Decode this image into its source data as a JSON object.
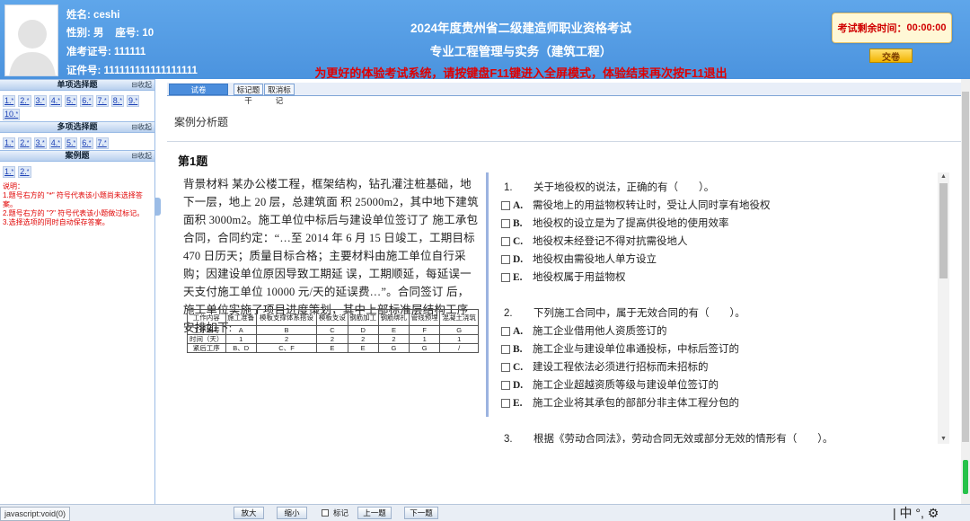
{
  "candidate": {
    "name_label": "姓名:",
    "name": "ceshi",
    "gender_label": "性别:",
    "gender": "男",
    "seat_label": "座号:",
    "seat": "10",
    "admission_label": "准考证号:",
    "admission_no": "111111",
    "id_label": "证件号:",
    "id_no": "111111111111111111"
  },
  "header": {
    "title": "2024年度贵州省二级建造师职业资格考试",
    "subtitle": "专业工程管理与实务（建筑工程）",
    "notice": "为更好的体验考试系统，请按键盘F11键进入全屏模式，体验结束再次按F11退出",
    "timer_label": "考试剩余时间：",
    "timer_value": "00:00:00",
    "submit_label": "交卷"
  },
  "sidebar": {
    "collapse_label": "收起",
    "sections": [
      {
        "title": "单项选择题",
        "items": [
          "1.",
          "2.",
          "3.",
          "4.",
          "5.",
          "6.",
          "7.",
          "8.",
          "9.",
          "10."
        ]
      },
      {
        "title": "多项选择题",
        "items": [
          "1.",
          "2.",
          "3.",
          "4.",
          "5.",
          "6.",
          "7."
        ]
      },
      {
        "title": "案例题",
        "items": [
          "1.",
          "2."
        ]
      }
    ],
    "star": "*",
    "notes": [
      "说明：",
      "1.题号右方的 \"*\" 符号代表该小题尚未选择答案。",
      "2.题号右方的 \"?\" 符号代表该小题做过标记。",
      "3.选择选项的同时自动保存答案。"
    ]
  },
  "tabs": [
    "试卷",
    "标记题干",
    "取消标记"
  ],
  "section_title": "案例分析题",
  "question_title": "第1题",
  "case_text": "背景材料 某办公楼工程，框架结构，钻孔灌注桩基础，地下一层，地上 20 层，总建筑面 积 25000m2，其中地下建筑面积 3000m2。施工单位中标后与建设单位签订了 施工承包合同，合同约定：“…至 2014 年 6 月 15 日竣工，工期目标 470 日历天；质量目标合格；主要材料由施工单位自行采购；因建设单位原因导致工期延 误，工期顺延，每延误一天支付施工单位 10000 元/天的延误费…”。合同签订 后，施工单位实施了项目进度策划，其中上部标准层结构工序安排如下:",
  "case_table": {
    "header": [
      "工作内容",
      "施工准备",
      "模板支撑体系搭设",
      "模板支设",
      "钢筋加工",
      "钢筋绑扎",
      "管线预埋",
      "混凝土浇筑"
    ],
    "rows": [
      [
        "工序编号",
        "A",
        "B",
        "C",
        "D",
        "E",
        "F",
        "G"
      ],
      [
        "时间（天）",
        "1",
        "2",
        "2",
        "2",
        "2",
        "1",
        "1"
      ],
      [
        "紧后工序",
        "B、D",
        "C、F",
        "E",
        "E",
        "G",
        "G",
        "/"
      ]
    ]
  },
  "questions": [
    {
      "num": "1.",
      "stem": "关于地役权的说法，正确的有（　　）。",
      "options": [
        {
          "letter": "A.",
          "text": "需役地上的用益物权转让时，受让人同时享有地役权"
        },
        {
          "letter": "B.",
          "text": "地役权的设立是为了提高供役地的使用效率"
        },
        {
          "letter": "C.",
          "text": "地役权未经登记不得对抗需役地人"
        },
        {
          "letter": "D.",
          "text": "地役权由需役地人单方设立"
        },
        {
          "letter": "E.",
          "text": "地役权属于用益物权"
        }
      ]
    },
    {
      "num": "2.",
      "stem": "下列施工合同中，属于无效合同的有（　　）。",
      "options": [
        {
          "letter": "A.",
          "text": "施工企业借用他人资质签订的"
        },
        {
          "letter": "B.",
          "text": "施工企业与建设单位串通投标，中标后签订的"
        },
        {
          "letter": "C.",
          "text": "建设工程依法必须进行招标而未招标的"
        },
        {
          "letter": "D.",
          "text": "施工企业超越资质等级与建设单位签订的"
        },
        {
          "letter": "E.",
          "text": "施工企业将其承包的部部分非主体工程分包的"
        }
      ]
    },
    {
      "num": "3.",
      "stem": "根据《劳动合同法》，劳动合同无效或部分无效的情形有（　　）。",
      "options": []
    }
  ],
  "bottom": {
    "status_url": "javascript:void(0)",
    "zoom_in": "放大",
    "zoom_out": "缩小",
    "mark": "标记",
    "prev": "上一题",
    "next": "下一题",
    "ime": "| 中 °, ⚙"
  },
  "colors": {
    "header_bg": "#4b93de",
    "notice": "#e00000",
    "timer_text": "#d00000",
    "accent": "#4b8ddc"
  }
}
